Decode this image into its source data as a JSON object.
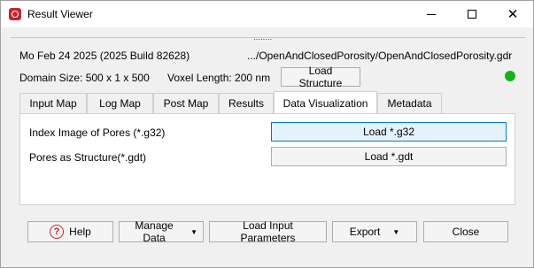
{
  "window": {
    "title": "Result Viewer"
  },
  "info": {
    "date_line": "Mo Feb 24 2025 (2025 Build 82628)",
    "path": ".../OpenAndClosedPorosity/OpenAndClosedPorosity.gdr",
    "domain_size": "Domain Size: 500 x 1 x 500",
    "voxel_length": "Voxel Length: 200 nm",
    "load_structure_label": "Load Structure",
    "status_color": "#0fb60f"
  },
  "tabs": [
    {
      "label": "Input Map",
      "active": false
    },
    {
      "label": "Log Map",
      "active": false
    },
    {
      "label": "Post Map",
      "active": false
    },
    {
      "label": "Results",
      "active": false
    },
    {
      "label": "Data Visualization",
      "active": true
    },
    {
      "label": "Metadata",
      "active": false
    }
  ],
  "panel": {
    "rows": [
      {
        "label": "Index Image of Pores (*.g32)",
        "button": "Load *.g32"
      },
      {
        "label": "Pores as Structure(*.gdt)",
        "button": "Load *.gdt"
      }
    ]
  },
  "footer": {
    "help": "Help",
    "manage_data": "Manage Data",
    "load_input_params": "Load Input Parameters",
    "export": "Export",
    "close": "Close"
  },
  "icons": {
    "app": "result-viewer-app-icon",
    "help": "help-icon",
    "dropdown": "chevron-down-icon"
  }
}
